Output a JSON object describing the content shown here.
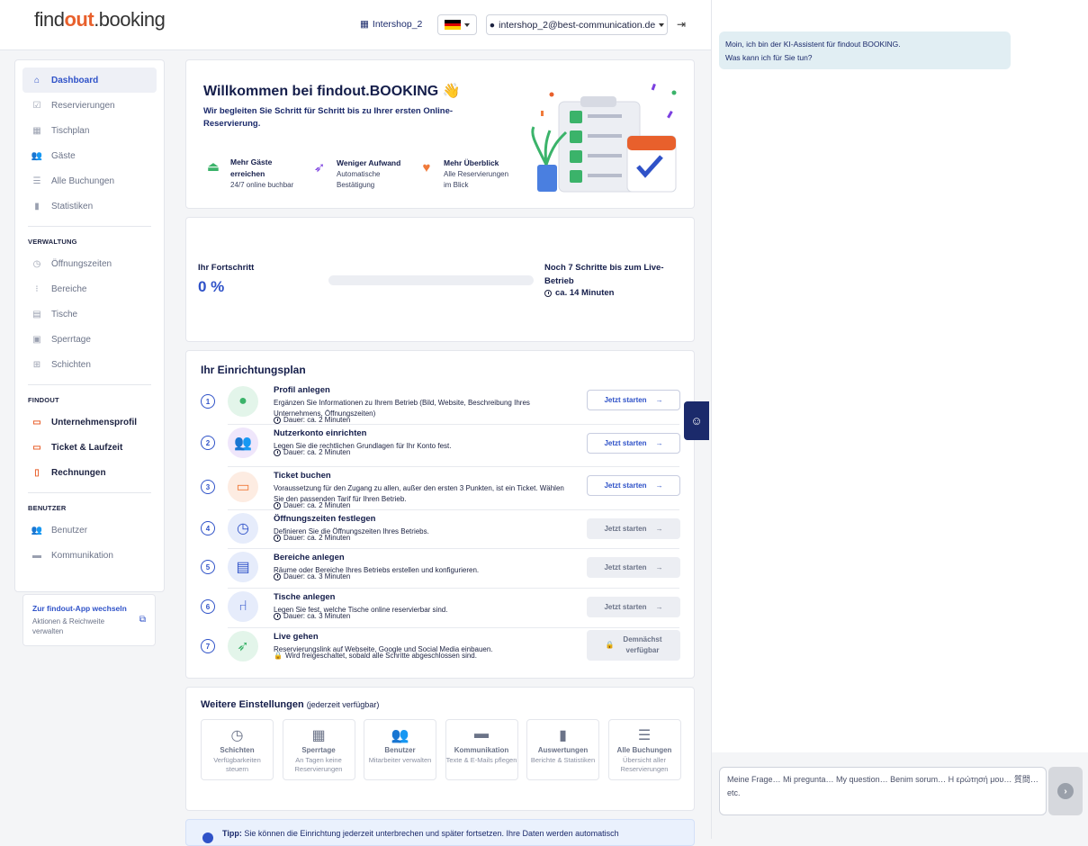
{
  "header": {
    "logo_prefix": "find",
    "logo_accent": "out",
    "logo_suffix": ".booking",
    "shop_label": "Intershop_2",
    "user_email": "intershop_2@best-communication.de",
    "language": "DE"
  },
  "sidebar": {
    "main_items": [
      {
        "label": "Dashboard",
        "icon": "home-icon"
      },
      {
        "label": "Reservierungen",
        "icon": "check-square-icon"
      },
      {
        "label": "Tischplan",
        "icon": "calendar-icon"
      },
      {
        "label": "Gäste",
        "icon": "users-icon"
      },
      {
        "label": "Alle Buchungen",
        "icon": "list-icon"
      },
      {
        "label": "Statistiken",
        "icon": "chart-icon"
      }
    ],
    "verwaltung_title": "VERWALTUNG",
    "verwaltung_items": [
      {
        "label": "Öffnungszeiten",
        "icon": "clock-icon"
      },
      {
        "label": "Bereiche",
        "icon": "grid-icon"
      },
      {
        "label": "Tische",
        "icon": "store-icon"
      },
      {
        "label": "Sperrtage",
        "icon": "calendar-x-icon"
      },
      {
        "label": "Schichten",
        "icon": "shift-icon"
      }
    ],
    "findout_title": "FINDOUT",
    "findout_items": [
      {
        "label": "Unternehmensprofil",
        "icon": "id-card-icon"
      },
      {
        "label": "Ticket & Laufzeit",
        "icon": "ticket-icon"
      },
      {
        "label": "Rechnungen",
        "icon": "invoice-icon"
      }
    ],
    "benutzer_title": "BENUTZER",
    "benutzer_items": [
      {
        "label": "Benutzer",
        "icon": "users-icon"
      },
      {
        "label": "Kommunikation",
        "icon": "chat-icon"
      }
    ],
    "app_switch": {
      "title": "Zur findout-App wechseln",
      "subtitle": "Aktionen & Reichweite verwalten"
    }
  },
  "welcome": {
    "title": "Willkommen bei findout.BOOKING 👋",
    "subtitle": "Wir begleiten Sie Schritt für Schritt bis zu Ihrer ersten Online-Reservierung.",
    "features": [
      {
        "title": "Mehr Gäste erreichen",
        "desc": "24/7 online buchbar",
        "icon": "bell-icon",
        "color": "#3bb36a"
      },
      {
        "title": "Weniger Aufwand",
        "desc": "Automatische Bestätigung",
        "icon": "rocket-icon",
        "color": "#7b3fe0"
      },
      {
        "title": "Mehr Überblick",
        "desc": "Alle Reservierungen im Blick",
        "icon": "heart-icon",
        "color": "#f07a3a"
      }
    ]
  },
  "progress": {
    "label": "Ihr Fortschritt",
    "percent_text": "0 %",
    "percent": 0,
    "steps_text": "Noch 7 Schritte bis zum Live-Betrieb",
    "duration_text": "ca. 14 Minuten"
  },
  "plan": {
    "title": "Ihr Einrichtungsplan",
    "steps": [
      {
        "num": "1",
        "title": "Profil anlegen",
        "desc": "Ergänzen Sie Informationen zu Ihrem Betrieb (Bild, Website, Beschreibung Ihres Unternehmens, Öffnungszeiten)",
        "duration": "Dauer: ca. 2 Minuten",
        "button": "Jetzt starten",
        "icon": "user-icon",
        "color": "#3bb36a",
        "bg": "#e3f5ea"
      },
      {
        "num": "2",
        "title": "Nutzerkonto einrichten",
        "desc": "Legen Sie die rechtlichen Grundlagen für Ihr Konto fest.",
        "duration": "Dauer: ca. 2 Minuten",
        "button": "Jetzt starten",
        "icon": "users-icon",
        "color": "#7b3fe0",
        "bg": "#efe6fb"
      },
      {
        "num": "3",
        "title": "Ticket buchen",
        "desc": "Voraussetzung für den Zugang zu allen, außer den ersten 3 Punkten, ist ein Ticket. Wählen Sie den passenden Tarif für Ihren Betrieb.",
        "duration": "Dauer: ca. 2 Minuten",
        "button": "Jetzt starten",
        "icon": "ticket-icon",
        "color": "#f07a3a",
        "bg": "#fdece2"
      },
      {
        "num": "4",
        "title": "Öffnungszeiten festlegen",
        "desc": "Definieren Sie die Öffnungszeiten Ihres Betriebs.",
        "duration": "Dauer: ca. 2 Minuten",
        "button": "Jetzt starten",
        "icon": "clock-icon",
        "color": "#2f52c8",
        "bg": "#e6ecfb"
      },
      {
        "num": "5",
        "title": "Bereiche anlegen",
        "desc": "Räume oder Bereiche Ihres Betriebs erstellen und konfigurieren.",
        "duration": "Dauer: ca. 3 Minuten",
        "button": "Jetzt starten",
        "icon": "store-icon",
        "color": "#2f52c8",
        "bg": "#e6ecfb"
      },
      {
        "num": "6",
        "title": "Tische anlegen",
        "desc": "Legen Sie fest, welche Tische online reservierbar sind.",
        "duration": "Dauer: ca. 3 Minuten",
        "button": "Jetzt starten",
        "icon": "chair-icon",
        "color": "#2f52c8",
        "bg": "#e6ecfb"
      },
      {
        "num": "7",
        "title": "Live gehen",
        "desc": "Reservierungslink auf Webseite, Google und Social Media einbauen.",
        "duration": "Wird freigeschaltet, sobald alle Schritte abgeschlossen sind.",
        "button": "Demnächst verfügbar",
        "icon": "rocket-icon",
        "color": "#3bb36a",
        "bg": "#e3f5ea"
      }
    ]
  },
  "more": {
    "title": "Weitere Einstellungen",
    "title_note": "(jederzeit verfügbar)",
    "tiles": [
      {
        "title": "Schichten",
        "desc": "Verfügbarkeiten steuern",
        "icon": "clock-icon"
      },
      {
        "title": "Sperrtage",
        "desc": "An Tagen keine Reservierungen",
        "icon": "calendar-icon"
      },
      {
        "title": "Benutzer",
        "desc": "Mitarbeiter verwalten",
        "icon": "users-icon"
      },
      {
        "title": "Kommunikation",
        "desc": "Texte & E-Mails pflegen",
        "icon": "chat-icon"
      },
      {
        "title": "Auswertungen",
        "desc": "Berichte & Statistiken",
        "icon": "chart-icon"
      },
      {
        "title": "Alle Buchungen",
        "desc": "Übersicht aller Reservierungen",
        "icon": "list-icon"
      }
    ]
  },
  "tip": {
    "label": "Tipp:",
    "text": "Sie können die Einrichtung jederzeit unterbrechen und später fortsetzen. Ihre Daten werden automatisch"
  },
  "chat": {
    "greeting_line1": "Moin, ich bin der KI-Assistent für findout BOOKING.",
    "greeting_line2": "Was kann ich für Sie tun?",
    "input_placeholder": "Meine Frage… Mi pregunta… My question… Benim sorum… Η ερώτησή μου… 質問… etc."
  }
}
